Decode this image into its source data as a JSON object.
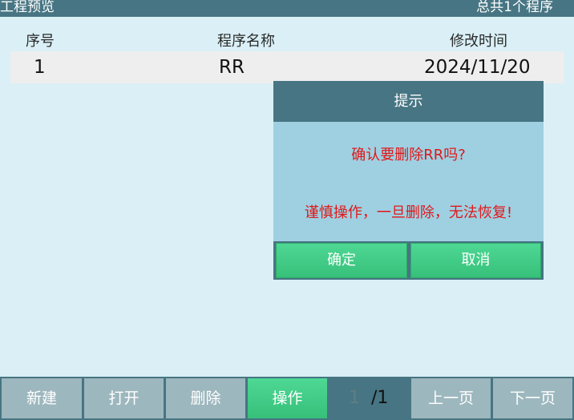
{
  "topbar": {
    "title": "工程预览",
    "count": "总共1个程序"
  },
  "table": {
    "headers": {
      "index": "序号",
      "name": "程序名称",
      "time": "修改时间"
    },
    "rows": [
      {
        "index": "1",
        "name": "RR",
        "time": "2024/11/20"
      }
    ]
  },
  "dialog": {
    "title": "提示",
    "message": "确认要删除RR吗?",
    "warning": "谨慎操作，一旦删除，无法恢复!",
    "ok_label": "确定",
    "cancel_label": "取消"
  },
  "toolbar": {
    "new_label": "新建",
    "open_label": "打开",
    "delete_label": "删除",
    "operate_label": "操作",
    "page_current": "1",
    "page_total": "/1",
    "prev_label": "上一页",
    "next_label": "下一页"
  },
  "colors": {
    "background": "#daf0f6",
    "header_bar": "#477583",
    "dialog_body": "#9ed0e2",
    "button_green": "#3fc985",
    "button_gray": "#9db7be",
    "warning_text": "#e01818"
  }
}
